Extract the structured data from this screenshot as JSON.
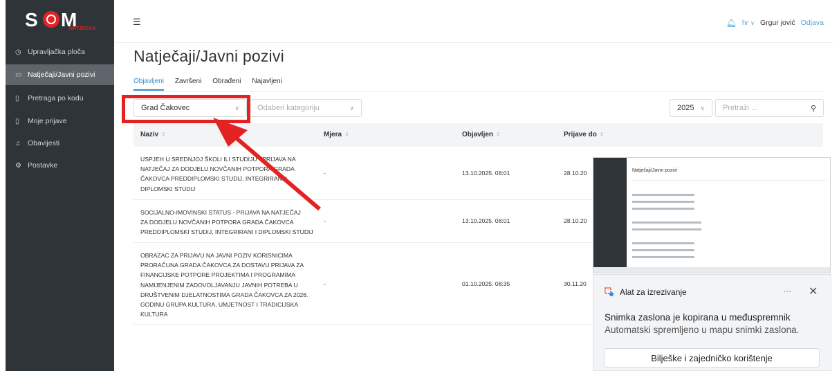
{
  "brand": {
    "logo_text": "NATJEČAJI"
  },
  "sidebar": {
    "items": [
      {
        "label": "Upravljačka ploča",
        "icon": "dashboard-icon"
      },
      {
        "label": "Natječaji/Javni pozivi",
        "icon": "folder-icon",
        "active": true
      },
      {
        "label": "Pretraga po kodu",
        "icon": "document-icon"
      },
      {
        "label": "Moje prijave",
        "icon": "document-icon"
      },
      {
        "label": "Obavijesti",
        "icon": "bell-icon"
      },
      {
        "label": "Postavke",
        "icon": "gear-icon"
      }
    ]
  },
  "header": {
    "lang": "hr",
    "user": "Grgur jović",
    "logout": "Odjava"
  },
  "page": {
    "title": "Natječaji/Javni pozivi"
  },
  "tabs": [
    "Objavljeni",
    "Završeni",
    "Obrađeni",
    "Najavljeni"
  ],
  "filters": {
    "city": "Grad Čakovec",
    "category_placeholder": "Odaberi kategoriju",
    "year": "2025",
    "search_placeholder": "Pretraži ..."
  },
  "table": {
    "columns": [
      "Naziv",
      "Mjera",
      "Objavljen",
      "Prijave do"
    ],
    "rows": [
      {
        "name_lines": [
          "USPJEH U SREDNJOJ ŠKOLI ILI STUDIJU - PRIJAVA NA",
          "NATJEČAJ ZA DODJELU NOVČANIH POTPORA GRADA",
          "ČAKOVCA PREDDIPLOMSKI STUDIJ, INTEGRIRANI I",
          "DIPLOMSKI STUDIJ"
        ],
        "mjera": "-",
        "objavljen": "13.10.2025. 08:01",
        "prijave_do": "28.10.20"
      },
      {
        "name_lines": [
          "SOCIJALNO-IMOVINSKI STATUS - PRIJAVA NA NATJEČAJ",
          "ZA DODJELU NOVČANIH POTPORA GRADA ČAKOVCA",
          "PREDDIPLOMSKI STUDIJ, INTEGRIRANI I DIPLOMSKI STUDIJ"
        ],
        "mjera": "-",
        "objavljen": "13.10.2025. 08:01",
        "prijave_do": "28.10.20"
      },
      {
        "name_lines": [
          "OBRAZAC ZA PRIJAVU NA JAVNI POZIV KORISNICIMA",
          "PRORAČUNA GRADA ČAKOVCA ZA DOSTAVU PRIJAVA ZA",
          "FINANCIJSKE POTPORE PROJEKTIMA I PROGRAMIMA",
          "NAMIJENJENIM ZADOVOLJAVANJU JAVNIH POTREBA U",
          "DRUŠTVENIM DJELATNOSTIMA GRADA ČAKOVCA ZA 2026.",
          "GODINU GRUPA KULTURA, UMJETNOST I TRADICIJSKA",
          "KULTURA"
        ],
        "mjera": "-",
        "objavljen": "01.10.2025. 08:35",
        "prijave_do": "30.11.20"
      }
    ]
  },
  "thumbnail": {
    "title": "Natječaji/Javni pozivi"
  },
  "toast": {
    "app": "Alat za izrezivanje",
    "more": "···",
    "line1": "Snimka zaslona je kopirana u međuspremnik",
    "line2": "Automatski spremljeno u mapu snimki zaslona.",
    "button": "Bilješke i zajedničko korištenje"
  },
  "colors": {
    "sidebar": "#2f3438",
    "accent": "#2f8bd1",
    "highlight": "#e32222"
  }
}
